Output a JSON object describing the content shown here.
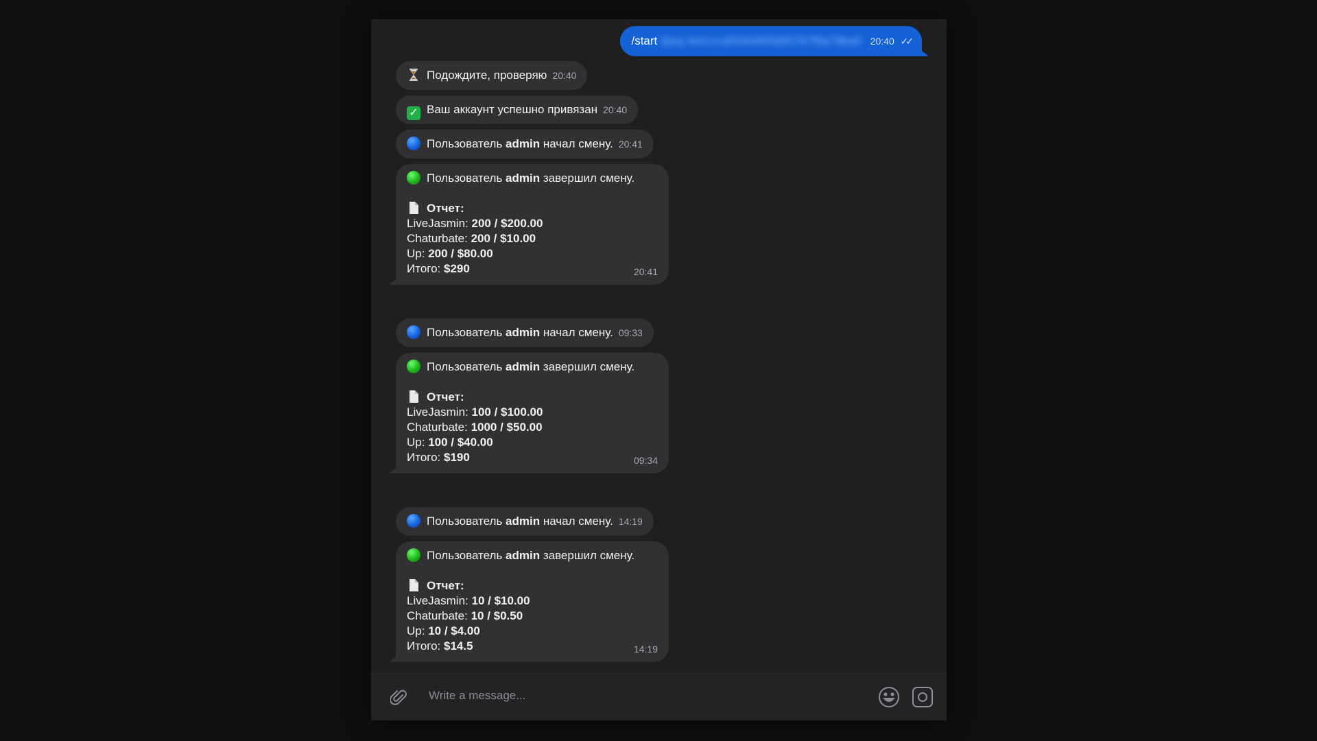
{
  "outgoing": {
    "text": "/start",
    "hidden_token": "tipsy-test:cca504e900d657b7f8a79ba0",
    "time": "20:40"
  },
  "messages": [
    {
      "type": "single",
      "icon": "hourglass-icon",
      "text": "Подождите, проверяю",
      "time": "20:40"
    },
    {
      "type": "single",
      "icon": "check-icon",
      "text": "Ваш аккаунт успешно привязан",
      "time": "20:40"
    },
    {
      "type": "single",
      "icon": "blue-circle-icon",
      "pre": "Пользователь ",
      "bold": "admin",
      "post": " начал смену.",
      "time": "20:41"
    },
    {
      "type": "report",
      "pre": "Пользователь ",
      "bold": "admin",
      "post": " завершил смену.",
      "report_label": "Отчет:",
      "rows": [
        {
          "label": "LiveJasmin: ",
          "value": "200 / $200.00"
        },
        {
          "label": "Chaturbate: ",
          "value": "200 / $10.00"
        },
        {
          "label": "Up: ",
          "value": "200 / $80.00"
        },
        {
          "label": "Итого: ",
          "value": "$290"
        }
      ],
      "time": "20:41"
    },
    {
      "type": "single",
      "icon": "blue-circle-icon",
      "pre": "Пользователь ",
      "bold": "admin",
      "post": " начал смену.",
      "time": "09:33"
    },
    {
      "type": "report",
      "pre": "Пользователь ",
      "bold": "admin",
      "post": " завершил смену.",
      "report_label": "Отчет:",
      "rows": [
        {
          "label": "LiveJasmin: ",
          "value": "100 / $100.00"
        },
        {
          "label": "Chaturbate: ",
          "value": "1000 / $50.00"
        },
        {
          "label": "Up: ",
          "value": "100 / $40.00"
        },
        {
          "label": "Итого: ",
          "value": "$190"
        }
      ],
      "time": "09:34"
    },
    {
      "type": "single",
      "icon": "blue-circle-icon",
      "pre": "Пользователь ",
      "bold": "admin",
      "post": " начал смену.",
      "time": "14:19"
    },
    {
      "type": "report",
      "pre": "Пользователь ",
      "bold": "admin",
      "post": " завершил смену.",
      "report_label": "Отчет:",
      "rows": [
        {
          "label": "LiveJasmin: ",
          "value": "10 / $10.00"
        },
        {
          "label": "Chaturbate: ",
          "value": "10 / $0.50"
        },
        {
          "label": "Up: ",
          "value": "10 / $4.00"
        },
        {
          "label": "Итого: ",
          "value": "$14.5"
        }
      ],
      "time": "14:19"
    }
  ],
  "composer": {
    "placeholder": "Write a message..."
  },
  "colors": {
    "background": "#0f0f10",
    "window": "#1f1f20",
    "incoming_bubble": "#313134",
    "outgoing_bubble": "#1561d6"
  }
}
